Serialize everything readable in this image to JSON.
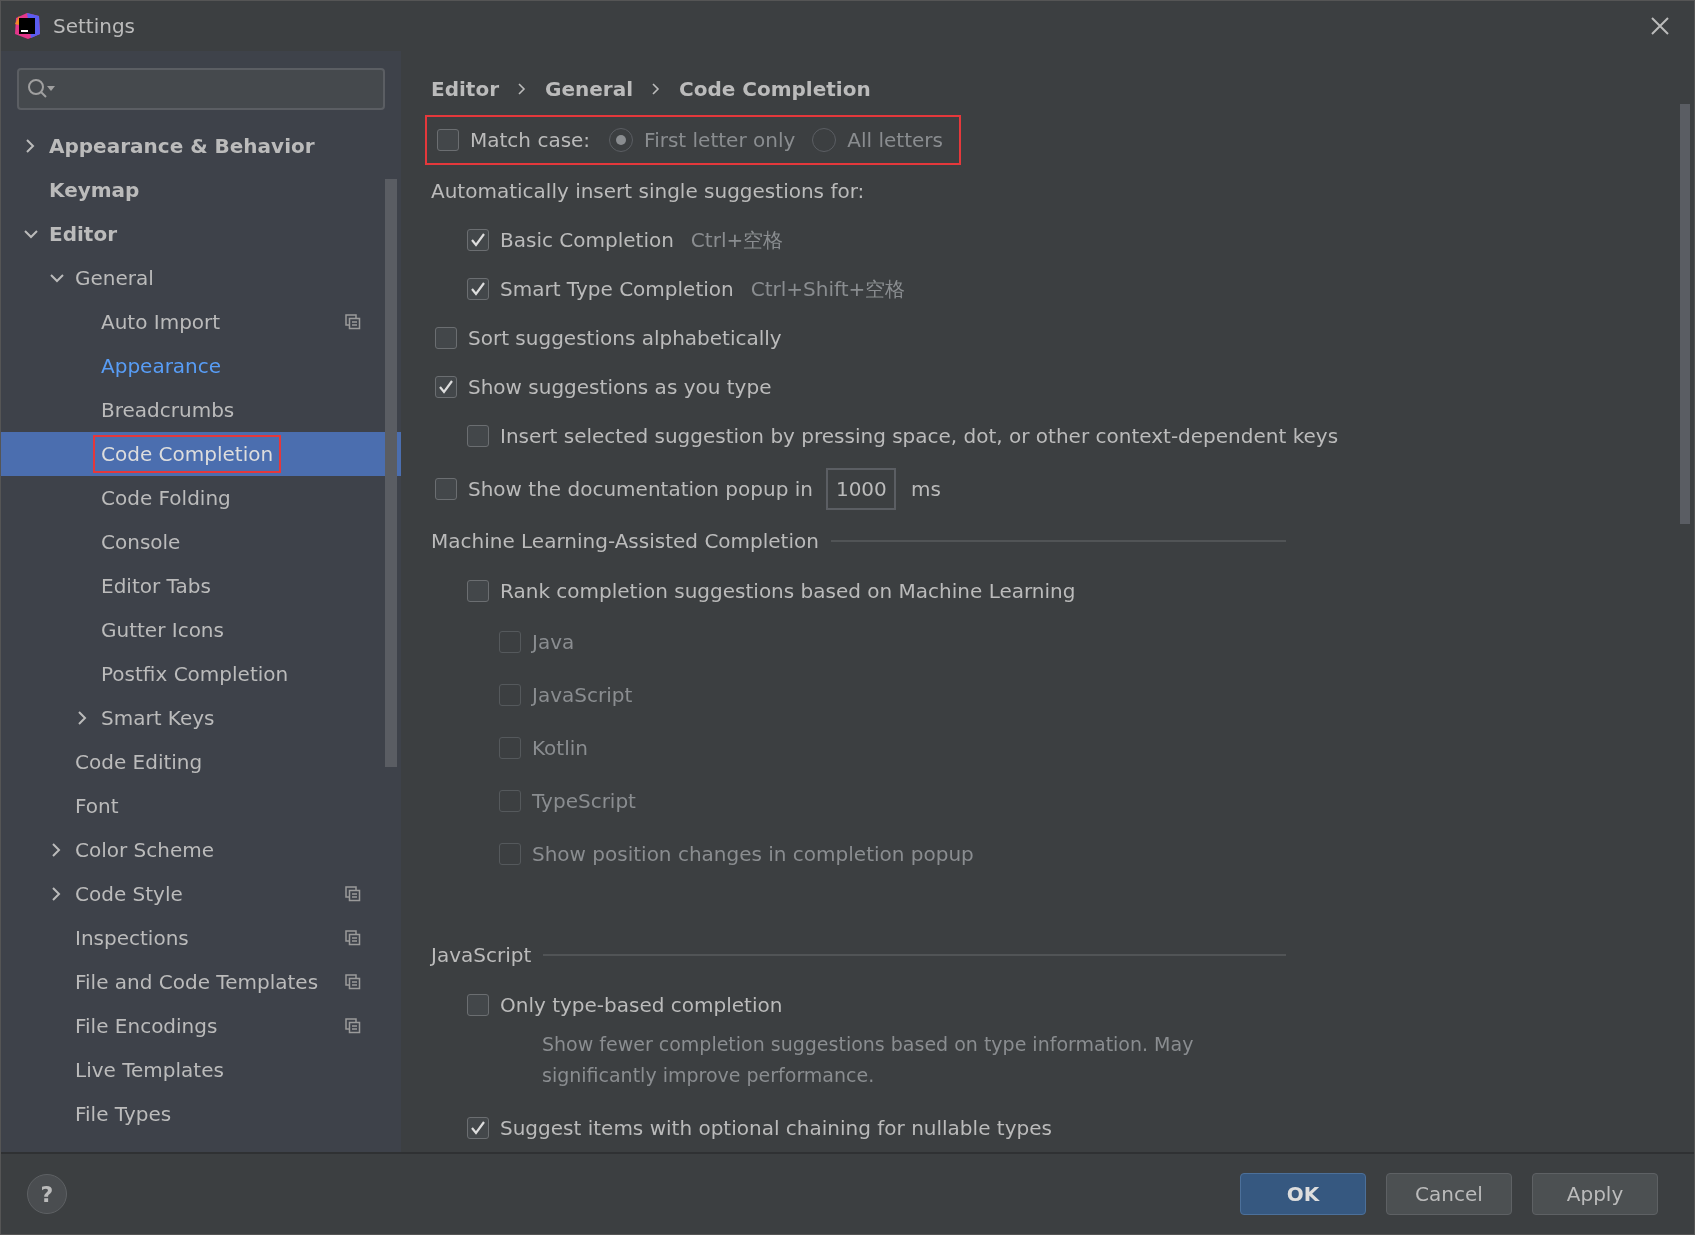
{
  "window": {
    "title": "Settings"
  },
  "sidebar": {
    "items": [
      {
        "label": "Appearance & Behavior",
        "bold": true,
        "expanded": false,
        "selected": false
      },
      {
        "label": "Keymap",
        "bold": true,
        "selected": false
      },
      {
        "label": "Editor",
        "bold": true,
        "expanded": true,
        "selected": false,
        "children": [
          {
            "label": "General",
            "expanded": true,
            "selected": false,
            "children": [
              {
                "label": "Auto Import",
                "project_scope": true,
                "selected": false
              },
              {
                "label": "Appearance",
                "modified": true,
                "selected": false
              },
              {
                "label": "Breadcrumbs",
                "selected": false
              },
              {
                "label": "Code Completion",
                "selected": true,
                "highlighted": true
              },
              {
                "label": "Code Folding",
                "selected": false
              },
              {
                "label": "Console",
                "selected": false
              },
              {
                "label": "Editor Tabs",
                "selected": false
              },
              {
                "label": "Gutter Icons",
                "selected": false
              },
              {
                "label": "Postfix Completion",
                "selected": false
              },
              {
                "label": "Smart Keys",
                "expanded": false,
                "selected": false
              }
            ]
          },
          {
            "label": "Code Editing",
            "selected": false
          },
          {
            "label": "Font",
            "selected": false
          },
          {
            "label": "Color Scheme",
            "expanded": false,
            "selected": false
          },
          {
            "label": "Code Style",
            "expanded": false,
            "project_scope": true,
            "selected": false
          },
          {
            "label": "Inspections",
            "project_scope": true,
            "selected": false
          },
          {
            "label": "File and Code Templates",
            "project_scope": true,
            "selected": false
          },
          {
            "label": "File Encodings",
            "project_scope": true,
            "selected": false
          },
          {
            "label": "Live Templates",
            "selected": false
          },
          {
            "label": "File Types",
            "selected": false
          }
        ]
      }
    ]
  },
  "breadcrumb": [
    "Editor",
    "General",
    "Code Completion"
  ],
  "options": [
    {
      "kind": "radio_group",
      "label": "Match case:",
      "checked": false,
      "highlighted": true,
      "choices": [
        {
          "label": "First letter only",
          "selected": true,
          "disabled": true
        },
        {
          "label": "All letters",
          "selected": false,
          "disabled": true
        }
      ]
    },
    {
      "kind": "label",
      "label": "Automatically insert single suggestions for:",
      "children": [
        {
          "kind": "checkbox",
          "label": "Basic Completion",
          "checked": true,
          "shortcut": "Ctrl+空格"
        },
        {
          "kind": "checkbox",
          "label": "Smart Type Completion",
          "checked": true,
          "shortcut": "Ctrl+Shift+空格"
        }
      ]
    },
    {
      "kind": "checkbox",
      "label": "Sort suggestions alphabetically",
      "checked": false
    },
    {
      "kind": "checkbox",
      "label": "Show suggestions as you type",
      "checked": true,
      "children": [
        {
          "kind": "checkbox",
          "label": "Insert selected suggestion by pressing space, dot, or other context-dependent keys",
          "checked": false
        }
      ]
    },
    {
      "kind": "number",
      "label": "Show the documentation popup in",
      "checked": false,
      "value": "1000",
      "unit": "ms"
    }
  ],
  "sections": [
    {
      "title": "Machine Learning-Assisted Completion",
      "options": [
        {
          "kind": "checkbox",
          "label": "Rank completion suggestions based on Machine Learning",
          "checked": false,
          "children": [
            {
              "kind": "checkbox",
              "label": "Java",
              "checked": false,
              "disabled": true
            },
            {
              "kind": "checkbox",
              "label": "JavaScript",
              "checked": false,
              "disabled": true
            },
            {
              "kind": "checkbox",
              "label": "Kotlin",
              "checked": false,
              "disabled": true
            },
            {
              "kind": "checkbox",
              "label": "TypeScript",
              "checked": false,
              "disabled": true
            },
            {
              "kind": "checkbox",
              "label": "Show position changes in completion popup",
              "checked": false,
              "disabled": true
            }
          ]
        }
      ]
    },
    {
      "title": "JavaScript",
      "options": [
        {
          "kind": "checkbox",
          "label": "Only type-based completion",
          "checked": false,
          "description": "Show fewer completion suggestions based on type information. May significantly improve performance."
        },
        {
          "kind": "checkbox",
          "label": "Suggest items with optional chaining for nullable types",
          "checked": true
        }
      ]
    }
  ],
  "footer": {
    "help": "?",
    "buttons": [
      {
        "label": "OK",
        "kind": "primary"
      },
      {
        "label": "Cancel",
        "kind": "secondary"
      },
      {
        "label": "Apply",
        "kind": "secondary"
      }
    ]
  }
}
